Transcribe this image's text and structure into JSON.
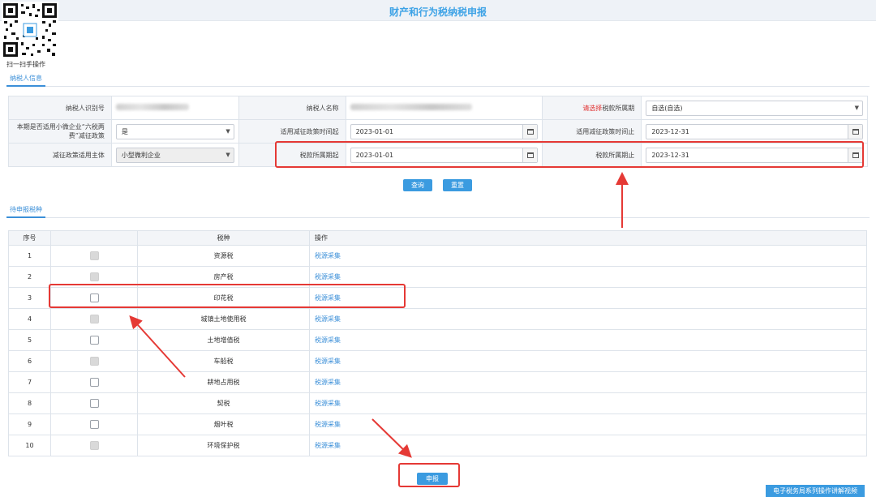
{
  "header": {
    "title": "财产和行为税纳税申报"
  },
  "qr": {
    "label": "扫一扫手操作"
  },
  "tabs": {
    "taxpayer_info": "纳税人信息",
    "pending": "待申报税种"
  },
  "form": {
    "taxpayer_id_label": "纳税人识别号",
    "taxpayer_name_label": "纳税人名称",
    "tax_period_prefix": "请选择",
    "tax_period_label": "税款所属期",
    "tax_period_value": "自选(自选)",
    "small_biz_label": "本期是否适用小微企业“六税两费”减征政策",
    "small_biz_value": "是",
    "policy_start_label": "适用减征政策时间起",
    "policy_start_value": "2023-01-01",
    "policy_end_label": "适用减征政策时间止",
    "policy_end_value": "2023-12-31",
    "subject_label": "减征政策适用主体",
    "subject_value": "小型微利企业",
    "period_start_label": "税款所属期起",
    "period_start_value": "2023-01-01",
    "period_end_label": "税款所属期止",
    "period_end_value": "2023-12-31"
  },
  "buttons": {
    "query": "查询",
    "reset": "重置",
    "declare": "申报",
    "video": "电子税务局系列操作讲解视频"
  },
  "list": {
    "headers": {
      "index": "序号",
      "tax_type": "税种",
      "operation": "操作"
    },
    "rows": [
      {
        "index": "1",
        "tax_type": "资源税",
        "operation": "税源采集"
      },
      {
        "index": "2",
        "tax_type": "房产税",
        "operation": "税源采集"
      },
      {
        "index": "3",
        "tax_type": "印花税",
        "operation": "税源采集"
      },
      {
        "index": "4",
        "tax_type": "城镇土地使用税",
        "operation": "税源采集"
      },
      {
        "index": "5",
        "tax_type": "土地增值税",
        "operation": "税源采集"
      },
      {
        "index": "6",
        "tax_type": "车船税",
        "operation": "税源采集"
      },
      {
        "index": "7",
        "tax_type": "耕地占用税",
        "operation": "税源采集"
      },
      {
        "index": "8",
        "tax_type": "契税",
        "operation": "税源采集"
      },
      {
        "index": "9",
        "tax_type": "烟叶税",
        "operation": "税源采集"
      },
      {
        "index": "10",
        "tax_type": "环境保护税",
        "operation": "税源采集"
      }
    ]
  },
  "colors": {
    "accent": "#3b9be0",
    "annotation": "#e53935"
  }
}
